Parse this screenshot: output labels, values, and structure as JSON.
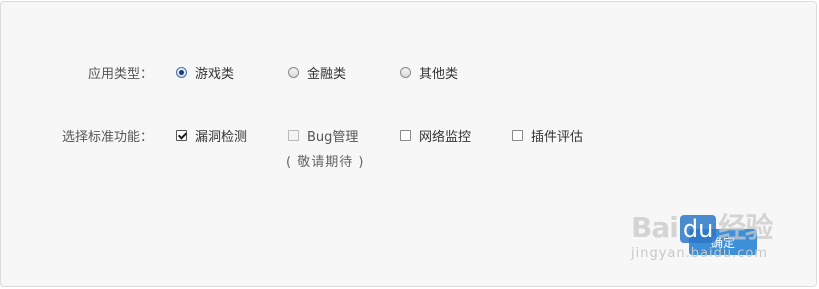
{
  "app_type": {
    "label": "应用类型：",
    "options": [
      {
        "label": "游戏类",
        "checked": true
      },
      {
        "label": "金融类",
        "checked": false
      },
      {
        "label": "其他类",
        "checked": false
      }
    ]
  },
  "features": {
    "label": "选择标准功能：",
    "options": [
      {
        "label": "漏洞检测",
        "checked": true,
        "disabled": false
      },
      {
        "label": "Bug管理",
        "checked": false,
        "disabled": true,
        "note": "( 敬请期待 )"
      },
      {
        "label": "网络监控",
        "checked": false,
        "disabled": false
      },
      {
        "label": "插件评估",
        "checked": false,
        "disabled": false
      }
    ]
  },
  "confirm": {
    "label": "确定"
  },
  "watermark": {
    "brand_left": "Bai",
    "brand_mid": "du",
    "brand_right": "经验",
    "url": "jingyan.baidu.com"
  },
  "colors": {
    "accent": "#3d8fd8",
    "panel_bg": "#f7f7f7"
  }
}
